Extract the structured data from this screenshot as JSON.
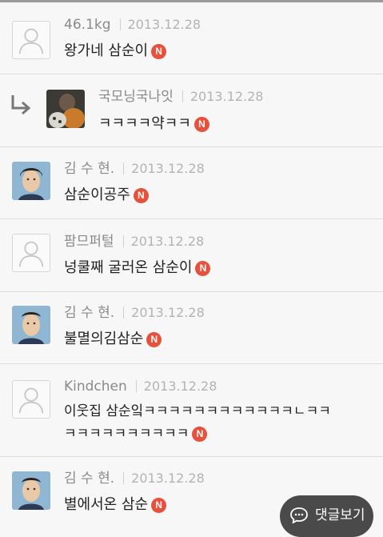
{
  "comments": [
    {
      "author": "46.1kg",
      "date": "2013.12.28",
      "text": "왕가네 삼순이",
      "avatar": "default-avatar",
      "reply": false
    },
    {
      "author": "국모닝국나잇",
      "date": "2013.12.28",
      "text": "ㅋㅋㅋㅋ약ㅋㅋ",
      "avatar": "photo-avatar",
      "reply": true
    },
    {
      "author": "김 수 현.",
      "date": "2013.12.28",
      "text": "삼순이공주",
      "avatar": "photo-avatar",
      "reply": false
    },
    {
      "author": "팜므퍼털",
      "date": "2013.12.28",
      "text": "넝쿨째 굴러온 삼순이",
      "avatar": "default-avatar",
      "reply": false
    },
    {
      "author": "김 수 현.",
      "date": "2013.12.28",
      "text": "불멸의김삼순",
      "avatar": "photo-avatar",
      "reply": false
    },
    {
      "author": "Kindchen",
      "date": "2013.12.28",
      "text_line1": "이웃집 삼순잌ㅋㅋㅋㅋㅋㅋㅋㅋㅋㅋㅋㅋㄴㅋㅋ",
      "text_line2": "ㅋㅋㅋㅋㅋㅋㅋㅋㅋㅋ",
      "avatar": "default-avatar",
      "reply": false
    },
    {
      "author": "김 수 현.",
      "date": "2013.12.28",
      "text": "별에서온 삼순",
      "avatar": "photo-avatar",
      "reply": false
    }
  ],
  "badge_label": "N",
  "comment_button": {
    "label": "댓글보기",
    "icon": "chat-bubble-icon"
  },
  "colors": {
    "badge": "#e7503a",
    "author": "#8a8a8a",
    "date": "#b3b3b3",
    "button_bg": "#4a4a4a"
  }
}
